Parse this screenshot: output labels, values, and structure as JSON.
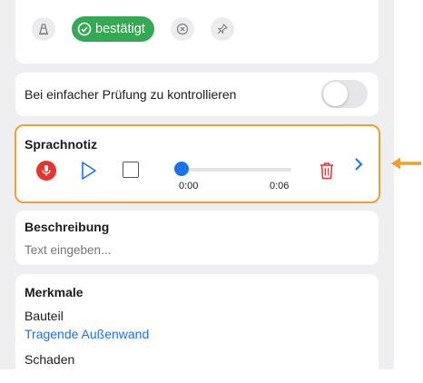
{
  "status": {
    "confirmed_label": "bestätigt",
    "icons": [
      "cone-icon",
      "check-circle-icon",
      "close-circle-icon",
      "pin-icon"
    ]
  },
  "check": {
    "label": "Bei einfacher Prüfung zu kontrollieren",
    "toggle_on": false
  },
  "voice_note": {
    "title": "Sprachnotiz",
    "time_current": "0:00",
    "time_total": "0:06",
    "progress": 0
  },
  "description": {
    "title": "Beschreibung",
    "placeholder": "Text eingeben..."
  },
  "features": {
    "title": "Merkmale",
    "items": [
      {
        "label": "Bauteil",
        "value": "Tragende Außenwand"
      },
      {
        "label": "Schaden",
        "value": ""
      }
    ]
  },
  "colors": {
    "accent_blue": "#1a73e8",
    "confirmed_green": "#34a853",
    "highlight_orange": "#f0a030",
    "record_red": "#e8332f"
  }
}
